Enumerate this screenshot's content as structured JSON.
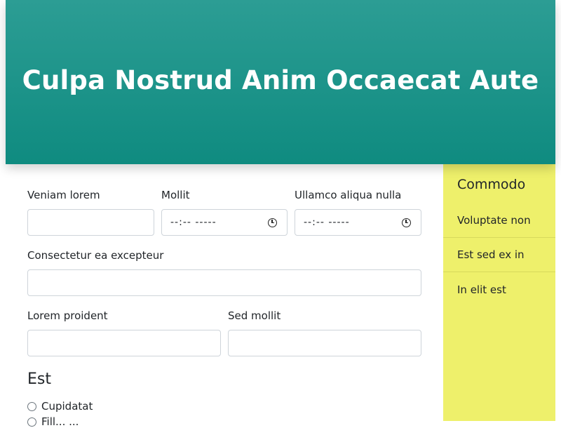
{
  "header": {
    "title": "Culpa Nostrud Anim Occaecat Aute"
  },
  "form": {
    "row1": [
      {
        "label": "Veniam lorem",
        "value": "",
        "type": "text"
      },
      {
        "label": "Mollit",
        "value": "--:-- -----",
        "type": "time"
      },
      {
        "label": "Ullamco aliqua nulla",
        "value": "--:-- -----",
        "type": "time"
      }
    ],
    "row2": [
      {
        "label": "Consectetur ea excepteur",
        "value": "",
        "type": "text"
      }
    ],
    "row3": [
      {
        "label": "Lorem proident",
        "value": "",
        "type": "text"
      },
      {
        "label": "Sed mollit",
        "value": "",
        "type": "text"
      }
    ],
    "section": {
      "title": "Est",
      "options": [
        "Cupidatat",
        "Fill... ..."
      ]
    }
  },
  "sidebar": {
    "title": "Commodo",
    "items": [
      {
        "label": "Voluptate non"
      },
      {
        "label": "Est sed ex in"
      },
      {
        "label": "In elit est"
      }
    ]
  },
  "colors": {
    "header_top": "#2c9d94",
    "header_bottom": "#0f8b80",
    "sidebar_bg": "#eef06b",
    "input_border": "#ced4da"
  },
  "icons": {
    "time_picker": "clock-icon",
    "radio": "radio-icon"
  }
}
